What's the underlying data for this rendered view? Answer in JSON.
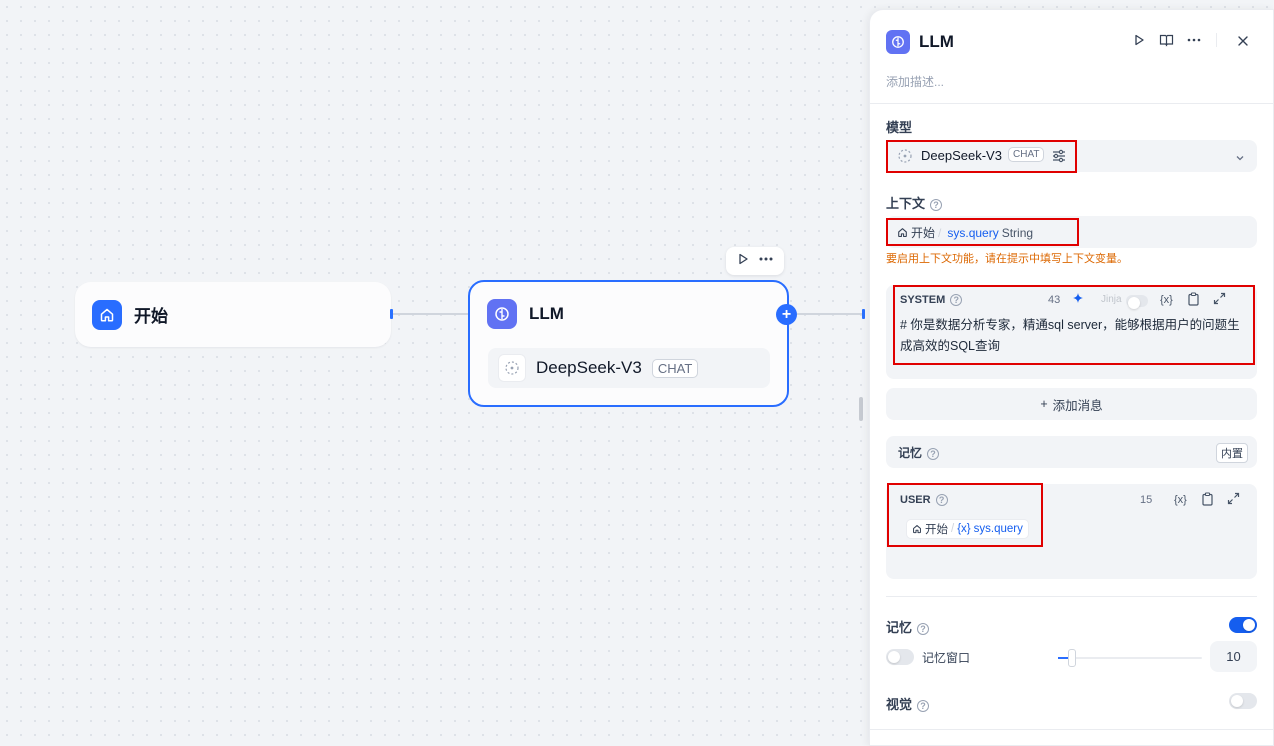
{
  "canvas": {
    "start_node": {
      "title": "开始"
    },
    "llm_node": {
      "title": "LLM",
      "model": "DeepSeek-V3",
      "model_mode": "CHAT"
    }
  },
  "panel": {
    "title": "LLM",
    "description_placeholder": "添加描述...",
    "model_section": {
      "label": "模型",
      "model": "DeepSeek-V3",
      "mode": "CHAT"
    },
    "context_section": {
      "label": "上下文",
      "node": "开始",
      "separator": "/",
      "variable": "sys.query",
      "type": "String",
      "warning": "要启用上下文功能，请在提示中填写上下文变量。"
    },
    "system_prompt": {
      "role": "SYSTEM",
      "count": "43",
      "jinja_label": "Jinja",
      "var_label": "{x}",
      "text": "# 你是数据分析专家，精通sql server，能够根据用户的问题生成高效的SQL查询"
    },
    "add_message_label": "添加消息",
    "memory_inline": {
      "label": "记忆",
      "badge": "内置"
    },
    "user_prompt": {
      "role": "USER",
      "count": "15",
      "var_label": "{x}",
      "node": "开始",
      "separator": "/",
      "variable_prefix": "{x}",
      "variable": "sys.query"
    },
    "memory": {
      "label": "记忆",
      "enabled": true
    },
    "memory_window": {
      "label": "记忆窗口",
      "enabled": false,
      "value": "10"
    },
    "vision": {
      "label": "视觉",
      "enabled": false
    }
  },
  "colors": {
    "accent": "#296dff",
    "highlight": "#e00000",
    "warning": "#dc6803"
  }
}
